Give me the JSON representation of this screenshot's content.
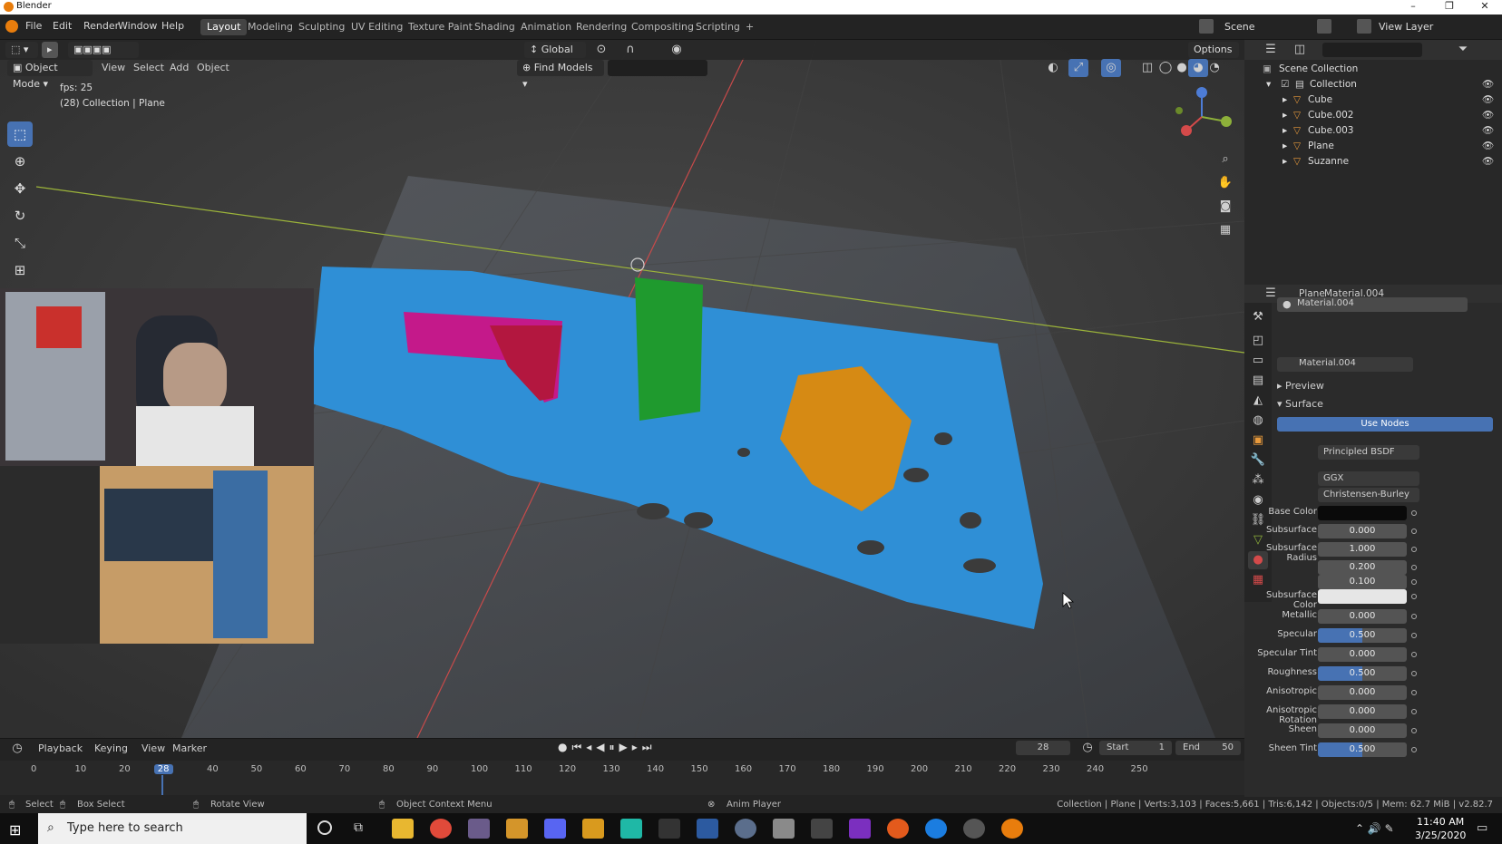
{
  "window": {
    "title": "Blender",
    "controls": [
      "–",
      "❐",
      "✕"
    ]
  },
  "menus": [
    "File",
    "Edit",
    "Render",
    "Window",
    "Help"
  ],
  "workspaces": [
    "Layout",
    "Modeling",
    "Sculpting",
    "UV Editing",
    "Texture Paint",
    "Shading",
    "Animation",
    "Rendering",
    "Compositing",
    "Scripting",
    "+"
  ],
  "active_workspace": "Layout",
  "scene": {
    "scene_label": "Scene",
    "view_layer_label": "View Layer"
  },
  "viewport": {
    "mode": "Object Mode",
    "header_menus": [
      "View",
      "Select",
      "Add",
      "Object"
    ],
    "transform_orientation": "Global",
    "find_models": "Find Models",
    "options": "Options",
    "fps": "fps: 25",
    "info": "(28) Collection | Plane"
  },
  "outliner": {
    "root": "Scene Collection",
    "collection": "Collection",
    "items": [
      {
        "name": "Cube"
      },
      {
        "name": "Cube.002"
      },
      {
        "name": "Cube.003"
      },
      {
        "name": "Plane"
      },
      {
        "name": "Suzanne"
      }
    ]
  },
  "properties": {
    "object": "Plane",
    "material": "Material.004",
    "slot": "Material.004",
    "datablock": "Material.004",
    "preview": "Preview",
    "surface_panel": "Surface",
    "use_nodes": "Use Nodes",
    "surface_label": "Surface",
    "surface_value": "Principled BSDF",
    "distribution": "GGX",
    "subsurface_method": "Christensen-Burley",
    "fields": [
      {
        "label": "Base Color",
        "value": "",
        "kind": "color_black"
      },
      {
        "label": "Subsurface",
        "value": "0.000",
        "kind": "num"
      },
      {
        "label": "Subsurface Radius",
        "value": "1.000",
        "kind": "num"
      },
      {
        "label": "",
        "value": "0.200",
        "kind": "num"
      },
      {
        "label": "",
        "value": "0.100",
        "kind": "num"
      },
      {
        "label": "Subsurface Color",
        "value": "",
        "kind": "color_white"
      },
      {
        "label": "Metallic",
        "value": "0.000",
        "kind": "num"
      },
      {
        "label": "Specular",
        "value": "0.500",
        "kind": "slider"
      },
      {
        "label": "Specular Tint",
        "value": "0.000",
        "kind": "num"
      },
      {
        "label": "Roughness",
        "value": "0.500",
        "kind": "slider"
      },
      {
        "label": "Anisotropic",
        "value": "0.000",
        "kind": "num"
      },
      {
        "label": "Anisotropic Rotation",
        "value": "0.000",
        "kind": "num"
      },
      {
        "label": "Sheen",
        "value": "0.000",
        "kind": "num"
      },
      {
        "label": "Sheen Tint",
        "value": "0.500",
        "kind": "slider"
      }
    ]
  },
  "timeline": {
    "menus": [
      "Playback",
      "Keying",
      "View",
      "Marker"
    ],
    "current_frame": "28",
    "start_label": "Start",
    "start": "1",
    "end_label": "End",
    "end": "50",
    "ticks": [
      "0",
      "10",
      "20",
      "28",
      "40",
      "50",
      "60",
      "70",
      "80",
      "90",
      "100",
      "110",
      "120",
      "130",
      "140",
      "150",
      "160",
      "170",
      "180",
      "190",
      "200",
      "210",
      "220",
      "230",
      "240",
      "250"
    ]
  },
  "statusbar": {
    "select": "Select",
    "box_select": "Box Select",
    "rotate": "Rotate View",
    "context": "Object Context Menu",
    "anim_player": "Anim Player",
    "stats": "Collection | Plane | Verts:3,103 | Faces:5,661 | Tris:6,142 | Objects:0/5 | Mem: 62.7 MiB | v2.82.7"
  },
  "taskbar": {
    "search_placeholder": "Type here to search",
    "time": "11:40 AM",
    "date": "3/25/2020"
  },
  "colors": {
    "accent": "#4772b3",
    "blender_orange": "#e87d0d",
    "fluid": "#2f8fd6"
  }
}
